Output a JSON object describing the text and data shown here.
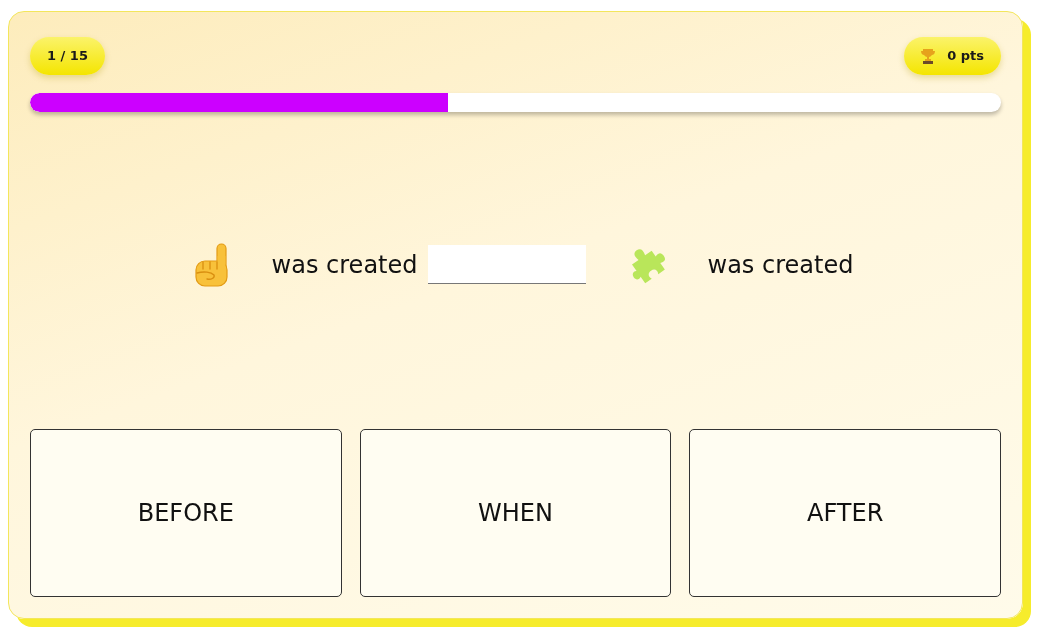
{
  "counter": "1 / 15",
  "score": "0 pts",
  "progress": {
    "level": 0.43
  },
  "question": {
    "first_event": "was created",
    "second_event": "was created"
  },
  "options": [
    {
      "label": "BEFORE",
      "selected": false
    },
    {
      "label": "WHEN",
      "selected": false
    },
    {
      "label": "AFTER",
      "selected": false
    }
  ]
}
